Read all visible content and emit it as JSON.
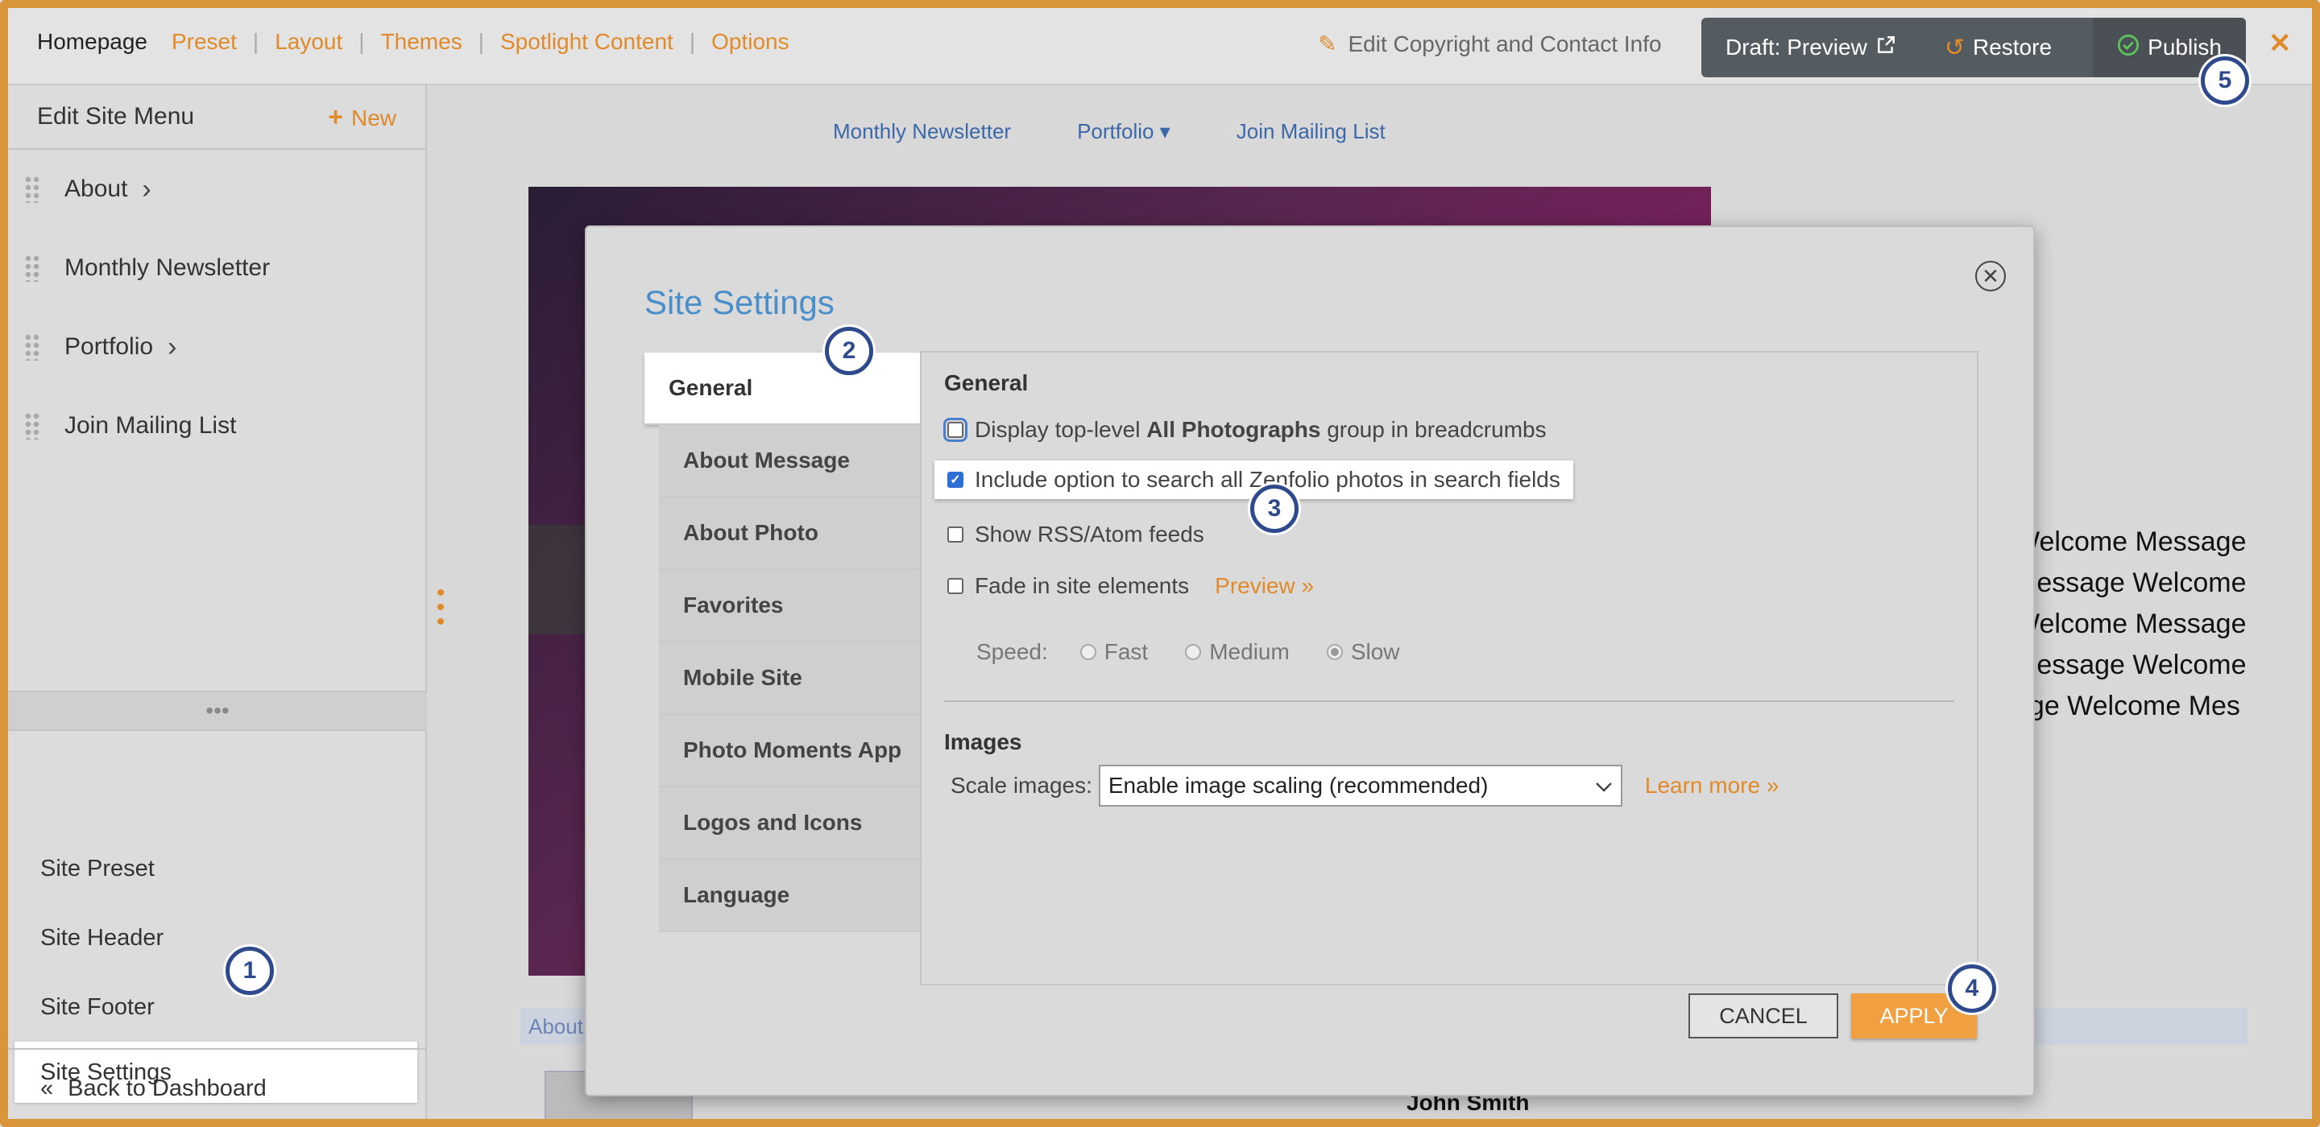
{
  "topnav": {
    "items": [
      "Homepage",
      "Preset",
      "Layout",
      "Themes",
      "Spotlight Content",
      "Options"
    ],
    "edit_copyright": "Edit Copyright and Contact Info",
    "draft_preview": "Draft: Preview",
    "restore": "Restore",
    "publish": "Publish"
  },
  "sidebar": {
    "title": "Edit Site Menu",
    "new_label": "New",
    "menu": [
      {
        "label": "About",
        "has_children": true
      },
      {
        "label": "Monthly Newsletter",
        "has_children": false
      },
      {
        "label": "Portfolio",
        "has_children": true
      },
      {
        "label": "Join Mailing List",
        "has_children": false
      }
    ],
    "bottom": [
      "Site Preset",
      "Site Header",
      "Site Footer",
      "Site Settings"
    ],
    "active_bottom": "Site Settings",
    "back": "Back to Dashboard"
  },
  "page": {
    "nav": [
      "Monthly Newsletter",
      "Portfolio ▾",
      "Join Mailing List"
    ],
    "welcome_lines": [
      "Welcome Message",
      "Message Welcome",
      "Welcome Message",
      "Message Welcome",
      "age Welcome Mes"
    ],
    "about_strip": "About",
    "name": "John Smith"
  },
  "modal": {
    "title": "Site Settings",
    "tabs": [
      "General",
      "About Message",
      "About Photo",
      "Favorites",
      "Mobile Site",
      "Photo Moments App",
      "Logos and Icons",
      "Language"
    ],
    "active_tab": "General",
    "general_heading": "General",
    "options": {
      "breadcrumbs_pre": "Display top-level ",
      "breadcrumbs_bold": "All Photographs",
      "breadcrumbs_post": " group in breadcrumbs",
      "search": "Include option to search all Zenfolio photos in search fields",
      "rss": "Show RSS/Atom feeds",
      "fade": "Fade in site elements",
      "preview": "Preview »"
    },
    "checked": {
      "breadcrumbs": false,
      "search": true,
      "rss": false,
      "fade": false
    },
    "speed_label": "Speed:",
    "speeds": [
      "Fast",
      "Medium",
      "Slow"
    ],
    "speed_selected": "Slow",
    "images_heading": "Images",
    "scale_label": "Scale images:",
    "scale_value": "Enable image scaling (recommended)",
    "learn_more": "Learn more »",
    "cancel": "CANCEL",
    "apply": "APPLY"
  },
  "badges": [
    "1",
    "2",
    "3",
    "4",
    "5"
  ],
  "colors": {
    "accent": "#e08a2a",
    "title_blue": "#4a8fc9",
    "badge": "#2f4a8c",
    "apply": "#f0a041"
  }
}
